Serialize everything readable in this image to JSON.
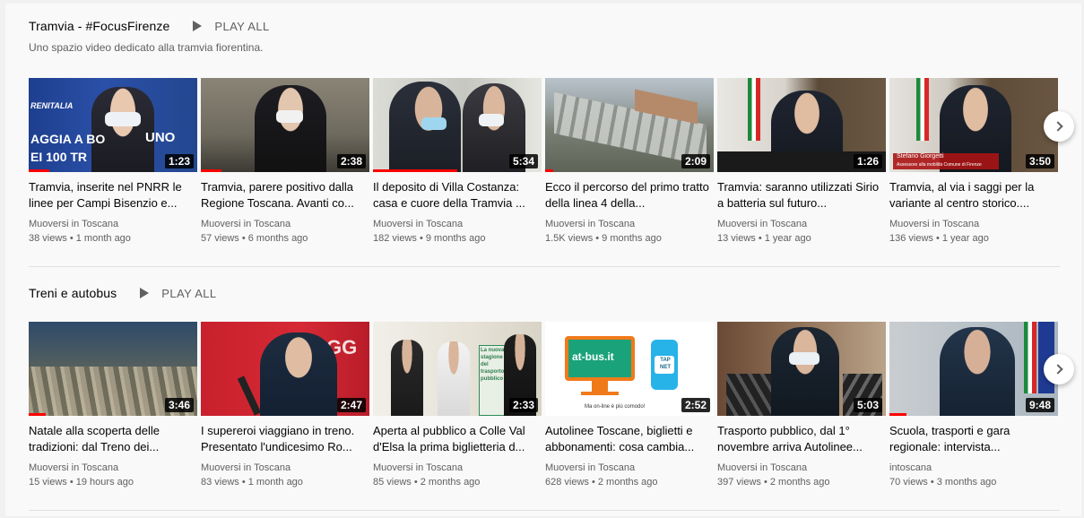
{
  "shelves": [
    {
      "title": "Tramvia - #FocusFirenze",
      "play_all": "PLAY ALL",
      "description": "Uno spazio video dedicato alla tramvia fiorentina.",
      "videos": [
        {
          "title": "Tramvia, inserite nel PNRR le linee per Campi Bisenzio e...",
          "channel": "Muoversi in Toscana",
          "meta": "38 views • 1 month ago",
          "duration": "1:23"
        },
        {
          "title": "Tramvia, parere positivo dalla Regione Toscana. Avanti co...",
          "channel": "Muoversi in Toscana",
          "meta": "57 views • 6 months ago",
          "duration": "2:38"
        },
        {
          "title": "Il deposito di Villa Costanza: casa e cuore della Tramvia ...",
          "channel": "Muoversi in Toscana",
          "meta": "182 views • 9 months ago",
          "duration": "5:34"
        },
        {
          "title": "Ecco il percorso del primo tratto della linea 4 della...",
          "channel": "Muoversi in Toscana",
          "meta": "1.5K views • 9 months ago",
          "duration": "2:09"
        },
        {
          "title": "Tramvia: saranno utilizzati Sirio a batteria sul futuro...",
          "channel": "Muoversi in Toscana",
          "meta": "13 views • 1 year ago",
          "duration": "1:26"
        },
        {
          "title": "Tramvia, al via i saggi per la variante al centro storico....",
          "channel": "Muoversi in Toscana",
          "meta": "136 views • 1 year ago",
          "duration": "3:50"
        }
      ]
    },
    {
      "title": "Treni e autobus",
      "play_all": "PLAY ALL",
      "videos": [
        {
          "title": "Natale alla scoperta delle tradizioni: dal Treno dei...",
          "channel": "Muoversi in Toscana",
          "meta": "15 views • 19 hours ago",
          "duration": "3:46"
        },
        {
          "title": "I supereroi viaggiano in treno. Presentato l'undicesimo Ro...",
          "channel": "Muoversi in Toscana",
          "meta": "83 views • 1 month ago",
          "duration": "2:47"
        },
        {
          "title": "Aperta al pubblico a Colle Val d'Elsa la prima biglietteria d...",
          "channel": "Muoversi in Toscana",
          "meta": "85 views • 2 months ago",
          "duration": "2:33"
        },
        {
          "title": "Autolinee Toscane, biglietti e abbonamenti: cosa cambia...",
          "channel": "Muoversi in Toscana",
          "meta": "628 views • 2 months ago",
          "duration": "2:52"
        },
        {
          "title": "Trasporto pubblico, dal 1° novembre arriva Autolinee...",
          "channel": "Muoversi in Toscana",
          "meta": "397 views • 2 months ago",
          "duration": "5:03"
        },
        {
          "title": "Scuola, trasporti e gara regionale: intervista...",
          "channel": "intoscana",
          "meta": "70 views • 3 months ago",
          "duration": "9:48"
        }
      ]
    }
  ],
  "thumb_text": {
    "v1_line1": "RENITALIA",
    "v1_line2": "AGGIA A BO",
    "v1_line3": "UNO",
    "v1_line4": "EI 100 TR",
    "v6_name": "Stefano Giorgetti",
    "v6_role": "Assessore alla mobilità Comune di Firenze",
    "v8_text": "IAGG",
    "v9_sign": "La nuova stagione del trasporto pubblico",
    "v10_logo": "at-bus.it",
    "v10_app": "TAP NET",
    "v10_caption": "Ma on-line è più comodo!"
  },
  "progress_fraction": [
    0.12,
    0.12,
    0.5,
    0.05,
    0.0,
    0.0,
    0.1,
    0.0,
    0.0,
    0.0,
    0.0,
    0.1
  ],
  "colors": {
    "accent": "#ff0000",
    "text_primary": "#030303",
    "text_secondary": "#606060"
  }
}
